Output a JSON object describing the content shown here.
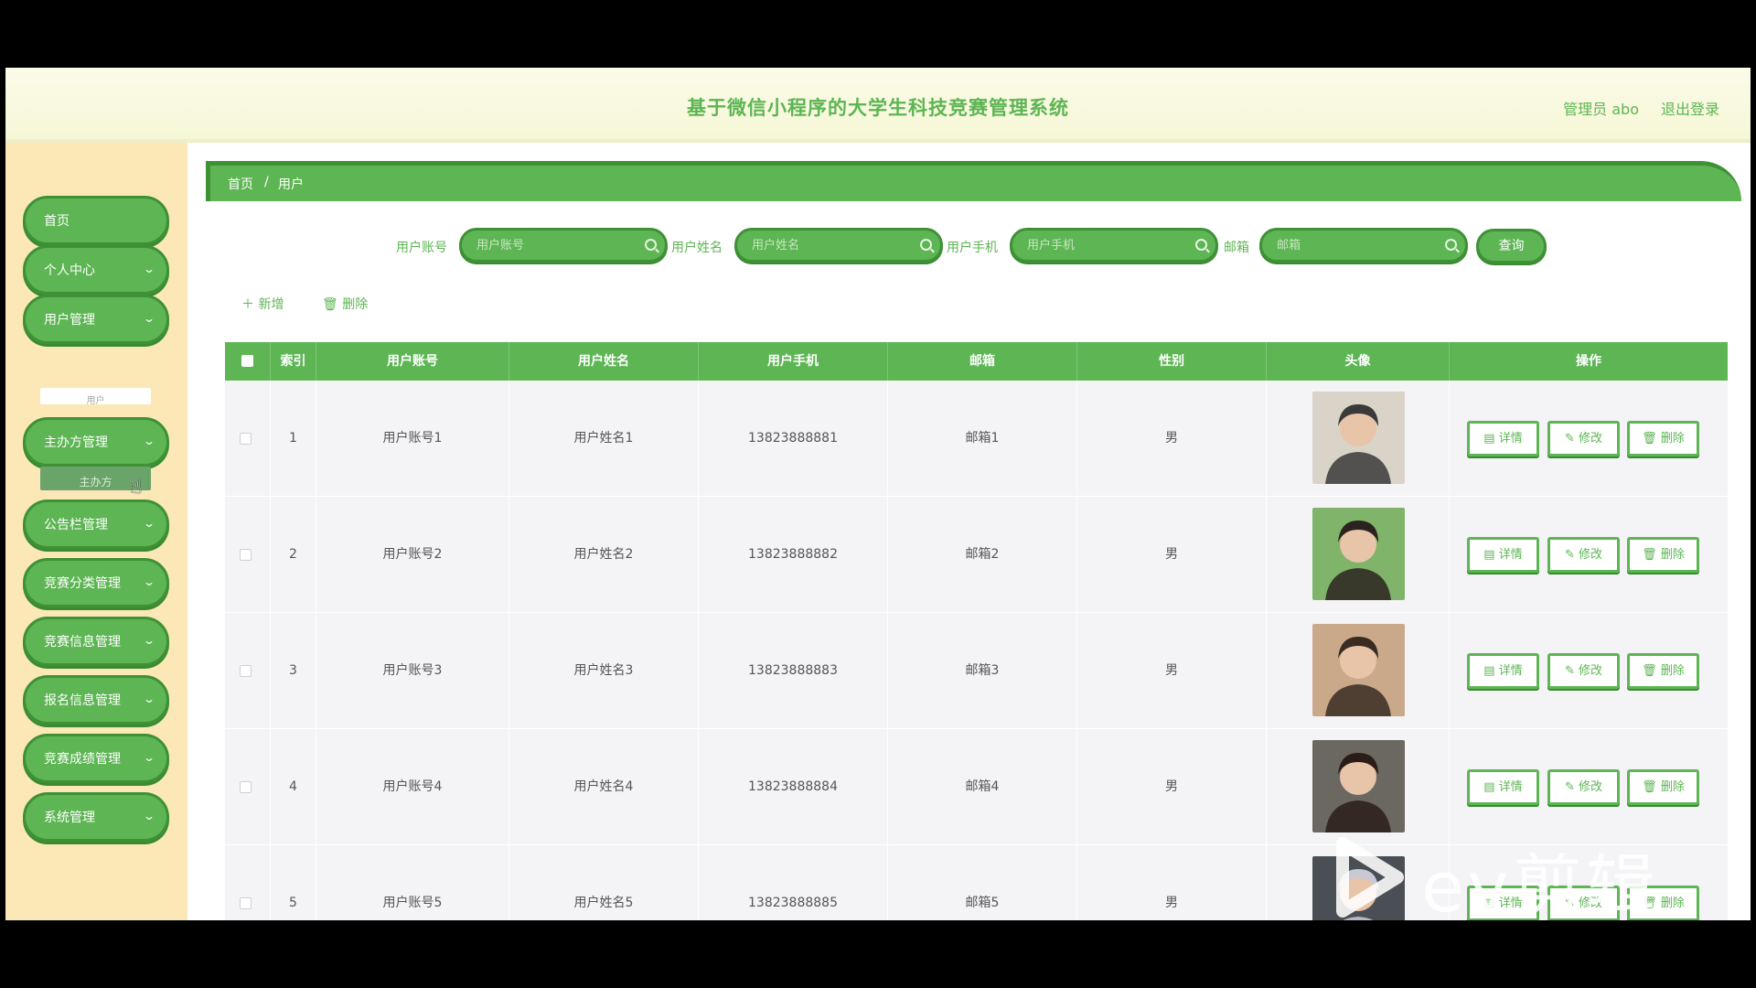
{
  "header": {
    "title": "基于微信小程序的大学生科技竞赛管理系统",
    "user": "管理员 abo",
    "logout": "退出登录"
  },
  "sidebar": {
    "items": [
      {
        "label": "首页",
        "has_chevron": false
      },
      {
        "label": "个人中心",
        "has_chevron": true
      },
      {
        "label": "用户管理",
        "has_chevron": true
      },
      {
        "label": "主办方管理",
        "has_chevron": true
      },
      {
        "label": "公告栏管理",
        "has_chevron": true
      },
      {
        "label": "竞赛分类管理",
        "has_chevron": true
      },
      {
        "label": "竞赛信息管理",
        "has_chevron": true
      },
      {
        "label": "报名信息管理",
        "has_chevron": true
      },
      {
        "label": "竞赛成绩管理",
        "has_chevron": true
      },
      {
        "label": "系统管理",
        "has_chevron": true
      }
    ],
    "sub_user": "用户",
    "sub_host": "主办方"
  },
  "breadcrumb": {
    "home": "首页",
    "sep": "/",
    "current": "用户"
  },
  "search": {
    "account_label": "用户账号",
    "account_placeholder": "用户账号",
    "name_label": "用户姓名",
    "name_placeholder": "用户姓名",
    "phone_label": "用户手机",
    "phone_placeholder": "用户手机",
    "email_label": "邮箱",
    "email_placeholder": "邮箱",
    "query": "查询"
  },
  "actions": {
    "add": "新增",
    "delete": "删除"
  },
  "table": {
    "headers": [
      "索引",
      "用户账号",
      "用户姓名",
      "用户手机",
      "邮箱",
      "性别",
      "头像",
      "操作"
    ],
    "ops": {
      "detail": "详情",
      "edit": "修改",
      "delete": "删除"
    },
    "rows": [
      {
        "index": "1",
        "account": "用户账号1",
        "name": "用户姓名1",
        "phone": "13823888881",
        "email": "邮箱1",
        "gender": "男"
      },
      {
        "index": "2",
        "account": "用户账号2",
        "name": "用户姓名2",
        "phone": "13823888882",
        "email": "邮箱2",
        "gender": "男"
      },
      {
        "index": "3",
        "account": "用户账号3",
        "name": "用户姓名3",
        "phone": "13823888883",
        "email": "邮箱3",
        "gender": "男"
      },
      {
        "index": "4",
        "account": "用户账号4",
        "name": "用户姓名4",
        "phone": "13823888884",
        "email": "邮箱4",
        "gender": "男"
      },
      {
        "index": "5",
        "account": "用户账号5",
        "name": "用户姓名5",
        "phone": "13823888885",
        "email": "邮箱5",
        "gender": "男"
      }
    ]
  },
  "watermark": "ev剪辑",
  "colors": {
    "primary": "#5db553",
    "primary_dark": "#3f9136",
    "sidebar_bg": "#fce8b7",
    "row_bg": "#f4f4f7"
  }
}
